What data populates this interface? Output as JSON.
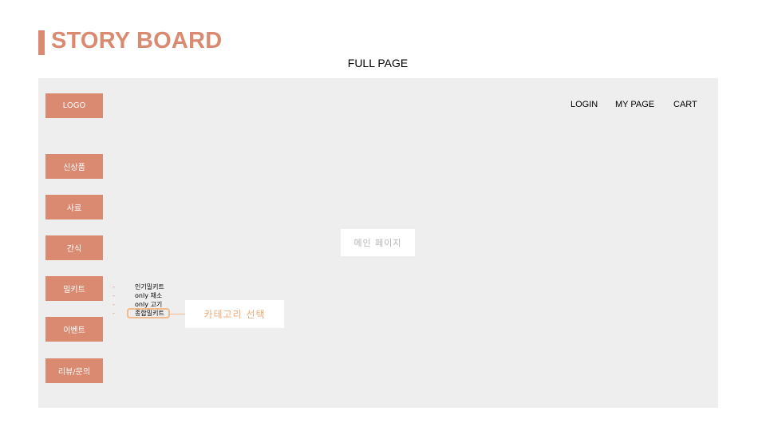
{
  "header": {
    "title": "STORY BOARD",
    "subtitle": "FULL PAGE"
  },
  "sidebar": {
    "logo": "LOGO",
    "items": [
      {
        "label": "신상품"
      },
      {
        "label": "사료"
      },
      {
        "label": "간식"
      },
      {
        "label": "밀키트"
      },
      {
        "label": "이벤트"
      },
      {
        "label": "리뷰/문의"
      }
    ]
  },
  "nav": {
    "login": "LOGIN",
    "mypage": "MY PAGE",
    "cart": "CART"
  },
  "main": {
    "label": "메인 페이지"
  },
  "submenu": {
    "dash": "-",
    "items": [
      {
        "label": "인기밀키트"
      },
      {
        "label": "only 채소"
      },
      {
        "label": "only 고기"
      },
      {
        "label": "종합밀키트"
      }
    ]
  },
  "annotation": {
    "label": "카테고리 선택"
  },
  "colors": {
    "accent": "#d98a70",
    "highlight": "#f2b98a",
    "canvas": "#eeeeee"
  }
}
